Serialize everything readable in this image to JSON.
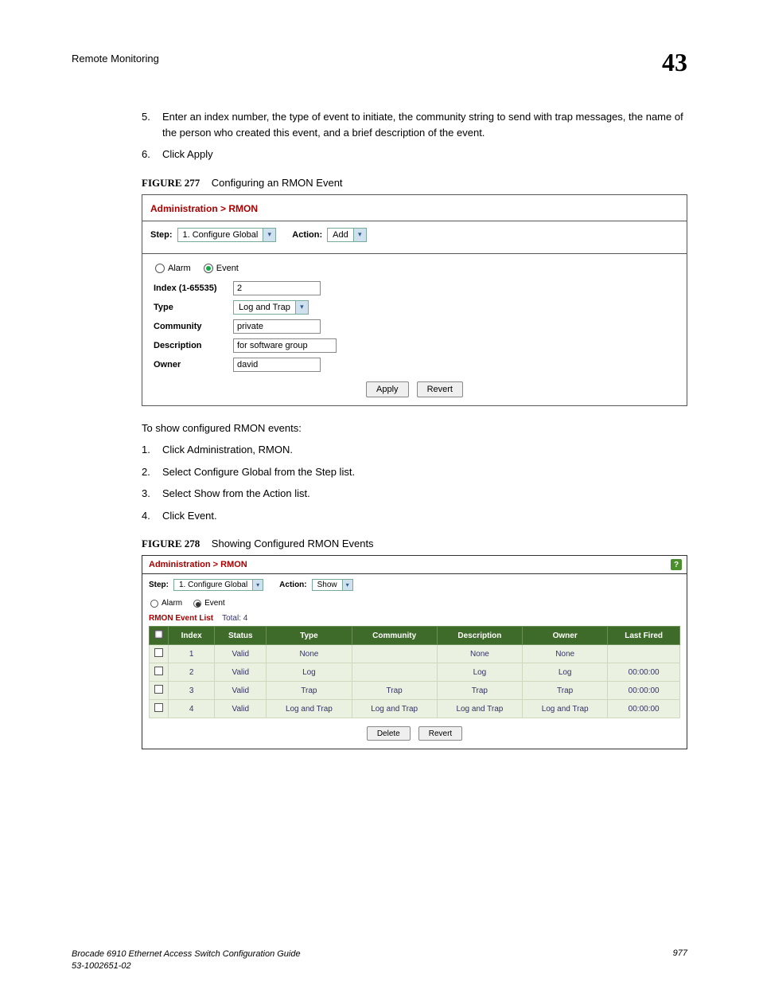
{
  "header": {
    "left": "Remote Monitoring",
    "right": "43"
  },
  "instr_top": [
    {
      "n": "5.",
      "t": "Enter an index number, the type of event to initiate, the community string to send with trap messages, the name of the person who created this event, and a brief description of the event."
    },
    {
      "n": "6.",
      "t": "Click Apply"
    }
  ],
  "fig277": {
    "label": "FIGURE 277",
    "caption": "Configuring an RMON Event"
  },
  "panel1": {
    "breadcrumb": "Administration > RMON",
    "step_label": "Step:",
    "step_value": "1. Configure Global",
    "action_label": "Action:",
    "action_value": "Add",
    "radio_alarm": "Alarm",
    "radio_event": "Event",
    "fields": {
      "index_label": "Index (1-65535)",
      "index_value": "2",
      "type_label": "Type",
      "type_value": "Log and Trap",
      "community_label": "Community",
      "community_value": "private",
      "description_label": "Description",
      "description_value": "for software group",
      "owner_label": "Owner",
      "owner_value": "david"
    },
    "btn_apply": "Apply",
    "btn_revert": "Revert"
  },
  "mid_para": "To show configured RMON events:",
  "instr_mid": [
    {
      "n": "1.",
      "t": "Click Administration, RMON."
    },
    {
      "n": "2.",
      "t": "Select Configure Global from the Step list."
    },
    {
      "n": "3.",
      "t": "Select Show from the Action list."
    },
    {
      "n": "4.",
      "t": "Click Event."
    }
  ],
  "fig278": {
    "label": "FIGURE 278",
    "caption": "Showing Configured RMON Events"
  },
  "panel2": {
    "breadcrumb": "Administration > RMON",
    "step_label": "Step:",
    "step_value": "1. Configure Global",
    "action_label": "Action:",
    "action_value": "Show",
    "radio_alarm": "Alarm",
    "radio_event": "Event",
    "list_title": "RMON Event List",
    "list_total": "Total: 4",
    "headers": [
      "",
      "Index",
      "Status",
      "Type",
      "Community",
      "Description",
      "Owner",
      "Last Fired"
    ],
    "rows": [
      {
        "index": "1",
        "status": "Valid",
        "type": "None",
        "community": "",
        "description": "None",
        "owner": "None",
        "last": ""
      },
      {
        "index": "2",
        "status": "Valid",
        "type": "Log",
        "community": "",
        "description": "Log",
        "owner": "Log",
        "last": "00:00:00"
      },
      {
        "index": "3",
        "status": "Valid",
        "type": "Trap",
        "community": "Trap",
        "description": "Trap",
        "owner": "Trap",
        "last": "00:00:00"
      },
      {
        "index": "4",
        "status": "Valid",
        "type": "Log and Trap",
        "community": "Log and Trap",
        "description": "Log and Trap",
        "owner": "Log and Trap",
        "last": "00:00:00"
      }
    ],
    "btn_delete": "Delete",
    "btn_revert": "Revert"
  },
  "footer": {
    "line1": "Brocade 6910 Ethernet Access Switch Configuration Guide",
    "line2": "53-1002651-02",
    "page": "977"
  }
}
